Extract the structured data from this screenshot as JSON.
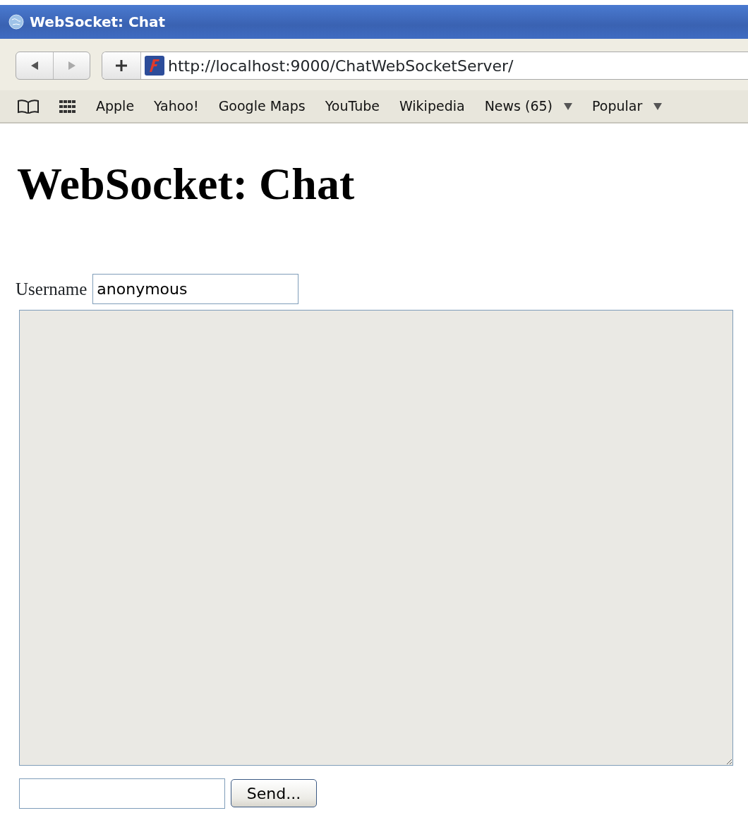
{
  "window": {
    "title": "WebSocket: Chat"
  },
  "toolbar": {
    "address": "http://localhost:9000/ChatWebSocketServer/"
  },
  "bookmarks": [
    {
      "label": "Apple",
      "kind": "link"
    },
    {
      "label": "Yahoo!",
      "kind": "link"
    },
    {
      "label": "Google Maps",
      "kind": "link"
    },
    {
      "label": "YouTube",
      "kind": "link"
    },
    {
      "label": "Wikipedia",
      "kind": "link"
    },
    {
      "label": "News (65)",
      "kind": "menu"
    },
    {
      "label": "Popular",
      "kind": "menu"
    }
  ],
  "page": {
    "heading": "WebSocket: Chat",
    "username_label": "Username",
    "username_value": "anonymous",
    "chat_log": {
      "disabled": true
    },
    "send_button": "Send..."
  }
}
